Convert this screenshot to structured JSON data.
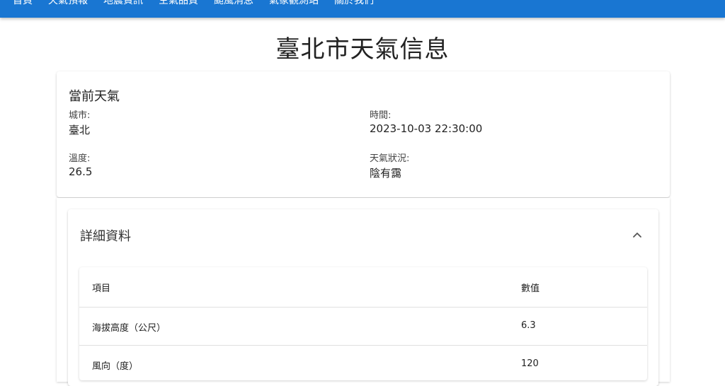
{
  "appbar": {
    "nav_items": [
      "首頁",
      "天氣預報",
      "地震資訊",
      "空氣品質",
      "颱風消息",
      "氣象觀測站",
      "關於我們"
    ]
  },
  "page": {
    "title": "臺北市天氣信息"
  },
  "current_weather": {
    "heading": "當前天氣",
    "city_label": "城市:",
    "city_value": "臺北",
    "time_label": "時間:",
    "time_value": "2023-10-03 22:30:00",
    "temp_label": "溫度:",
    "temp_value": "26.5",
    "condition_label": "天氣狀況:",
    "condition_value": "陰有靄"
  },
  "details": {
    "heading": "詳細資料",
    "expanded": true,
    "columns": [
      "項目",
      "數值"
    ],
    "rows": [
      {
        "item": "海拔高度（公尺）",
        "value": "6.3"
      },
      {
        "item": "風向（度）",
        "value": "120"
      }
    ]
  },
  "colors": {
    "appbar": "#1976d2"
  }
}
